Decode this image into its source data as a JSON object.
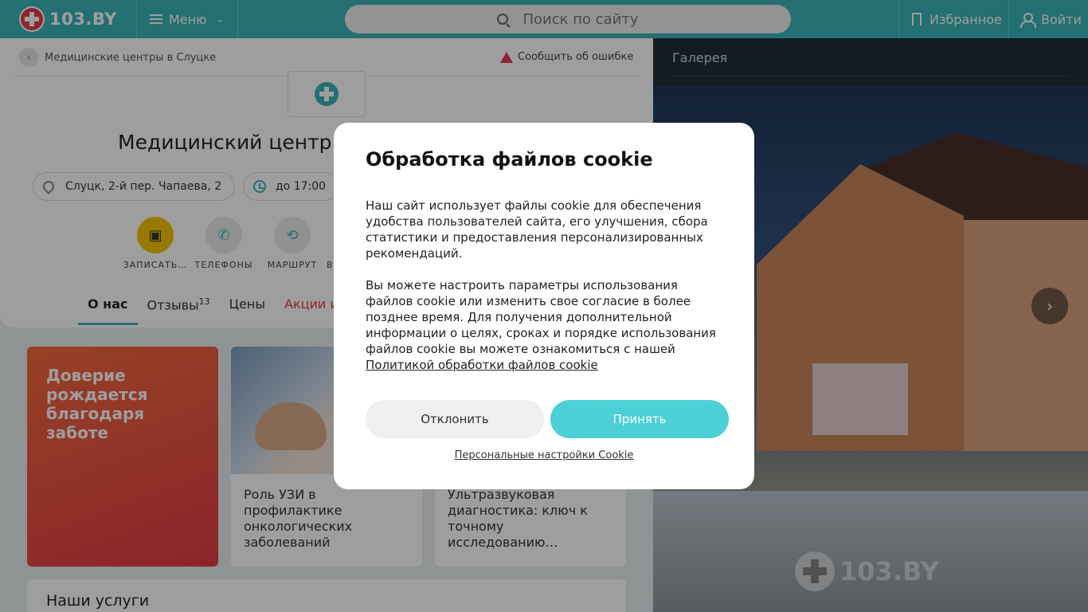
{
  "header": {
    "logo_text": "103.BY",
    "menu_label": "Меню",
    "search_placeholder": "Поиск по сайту",
    "favorites_label": "Избранное",
    "login_label": "Войти",
    "accent": "#3ab4b8"
  },
  "breadcrumb": {
    "text": "Медицинские центры в Слуцке",
    "report_label": "Сообщить об ошибке"
  },
  "clinic": {
    "title": "Медицинский центр «",
    "address": "Слуцк, 2-й пер. Чапаева, 2",
    "hours": "до 17:00"
  },
  "actions": [
    {
      "label": "ЗАПИСАТЬ…",
      "icon": "calendar-icon"
    },
    {
      "label": "ТЕЛЕФОНЫ",
      "icon": "phone-icon"
    },
    {
      "label": "МАРШРУТ",
      "icon": "route-icon"
    },
    {
      "label": "В",
      "icon": "more-icon"
    }
  ],
  "tabs": [
    {
      "label": "О нас"
    },
    {
      "label": "Отзывы",
      "count": "13"
    },
    {
      "label": "Цены"
    },
    {
      "label": "Акции и"
    }
  ],
  "promo": {
    "line1": "Доверие",
    "line2": "рождается",
    "line3": "благодаря",
    "line4": "заботе"
  },
  "articles": [
    {
      "title": "Роль УЗИ в профилактике онкологических заболеваний"
    },
    {
      "title": "Ультразвуковая диагностика: ключ к точному исследованию…"
    }
  ],
  "services_title": "Наши услуги",
  "gallery": {
    "title": "Галерея",
    "watermark": "103.BY"
  },
  "cookie_modal": {
    "title": "Обработка файлов cookie",
    "paragraph1": "Наш сайт использует файлы cookie для обеспечения удобства пользователей сайта, его улучшения, сбора статистики и предоставления персонализированных рекомендаций.",
    "paragraph2": "Вы можете настроить параметры использования файлов cookie или изменить свое согласие в более позднее время. Для получения дополнительной информации о целях, сроках и порядке использования файлов cookie вы можете ознакомиться с нашей",
    "policy_link": "Политикой обработки файлов cookie",
    "decline_label": "Отклонить",
    "accept_label": "Принять",
    "personal_settings": "Персональные настройки Cookie"
  }
}
